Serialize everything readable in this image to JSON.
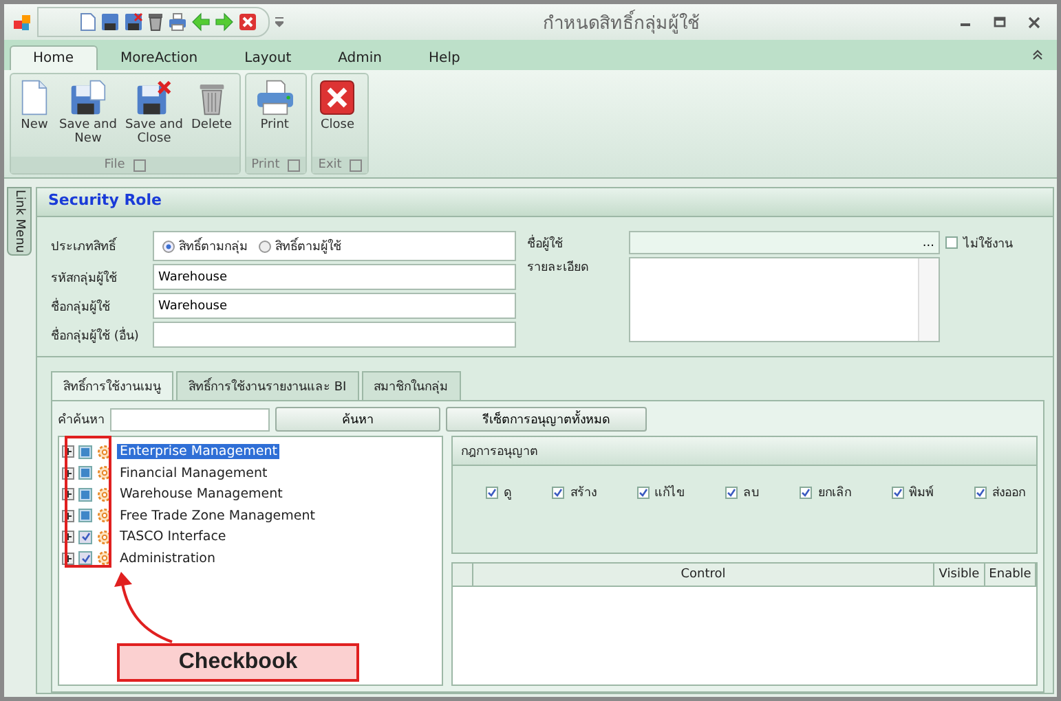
{
  "window": {
    "title": "กำหนดสิทธิ์กลุ่มผู้ใช้"
  },
  "ribbon_tabs": [
    {
      "label": "Home",
      "selected": true
    },
    {
      "label": "MoreAction",
      "selected": false
    },
    {
      "label": "Layout",
      "selected": false
    },
    {
      "label": "Admin",
      "selected": false
    },
    {
      "label": "Help",
      "selected": false
    }
  ],
  "ribbon_groups": [
    {
      "label": "File",
      "buttons": [
        {
          "label": "New",
          "kind": "new"
        },
        {
          "label": "Save and New",
          "kind": "save"
        },
        {
          "label": "Save and Close",
          "kind": "saveclose"
        },
        {
          "label": "Delete",
          "kind": "delete"
        }
      ]
    },
    {
      "label": "Print",
      "buttons": [
        {
          "label": "Print",
          "kind": "print"
        }
      ]
    },
    {
      "label": "Exit",
      "buttons": [
        {
          "label": "Close",
          "kind": "close"
        }
      ]
    }
  ],
  "side_tab": "Link Menu",
  "panel_title": "Security Role",
  "form": {
    "type_label": "ประเภทสิทธิ์",
    "radios": [
      {
        "label": "สิทธิ์ตามกลุ่ม",
        "selected": true
      },
      {
        "label": "สิทธิ์ตามผู้ใช้",
        "selected": false
      }
    ],
    "fields": [
      {
        "label": "รหัสกลุ่มผู้ใช้",
        "value": "Warehouse"
      },
      {
        "label": "ชื่อกลุ่มผู้ใช้",
        "value": "Warehouse"
      },
      {
        "label": "ชื่อกลุ่มผู้ใช้ (อื่น)"
      }
    ],
    "user_label": "ชื่อผู้ใช้",
    "user_button": "...",
    "inactive": {
      "label": "ไม่ใช้งาน",
      "checked": false
    },
    "detail_label": "รายละเอียด"
  },
  "tabs": [
    {
      "label": "สิทธิ์การใช้งานเมนู",
      "selected": true
    },
    {
      "label": "สิทธิ์การใช้งานรายงานและ BI",
      "selected": false
    },
    {
      "label": "สมาชิกในกลุ่ม",
      "selected": false
    }
  ],
  "search": {
    "label": "คำค้นหา",
    "button": "ค้นหา",
    "reset_button": "รีเซ็ตการอนุญาตทั้งหมด"
  },
  "tree": [
    {
      "label": "Enterprise Management",
      "checked": false,
      "partial": true,
      "selected": true
    },
    {
      "label": "Financial Management",
      "checked": false,
      "partial": true,
      "selected": false
    },
    {
      "label": "Warehouse Management",
      "checked": false,
      "partial": true,
      "selected": false
    },
    {
      "label": "Free Trade Zone Management",
      "checked": false,
      "partial": true,
      "selected": false
    },
    {
      "label": "TASCO Interface",
      "checked": true,
      "partial": false,
      "selected": false
    },
    {
      "label": "Administration",
      "checked": true,
      "partial": false,
      "selected": false
    }
  ],
  "permissions": {
    "title": "กฎการอนุญาต",
    "items": [
      {
        "label": "ดู",
        "checked": true
      },
      {
        "label": "สร้าง",
        "checked": true
      },
      {
        "label": "แก้ไข",
        "checked": true
      },
      {
        "label": "ลบ",
        "checked": true
      },
      {
        "label": "ยกเลิก",
        "checked": true
      },
      {
        "label": "พิมพ์",
        "checked": true
      },
      {
        "label": "ส่งออก",
        "checked": true
      }
    ]
  },
  "grid": {
    "columns": [
      "Control",
      "Visible",
      "Enable"
    ]
  },
  "annotation": {
    "label": "Checkbook"
  }
}
